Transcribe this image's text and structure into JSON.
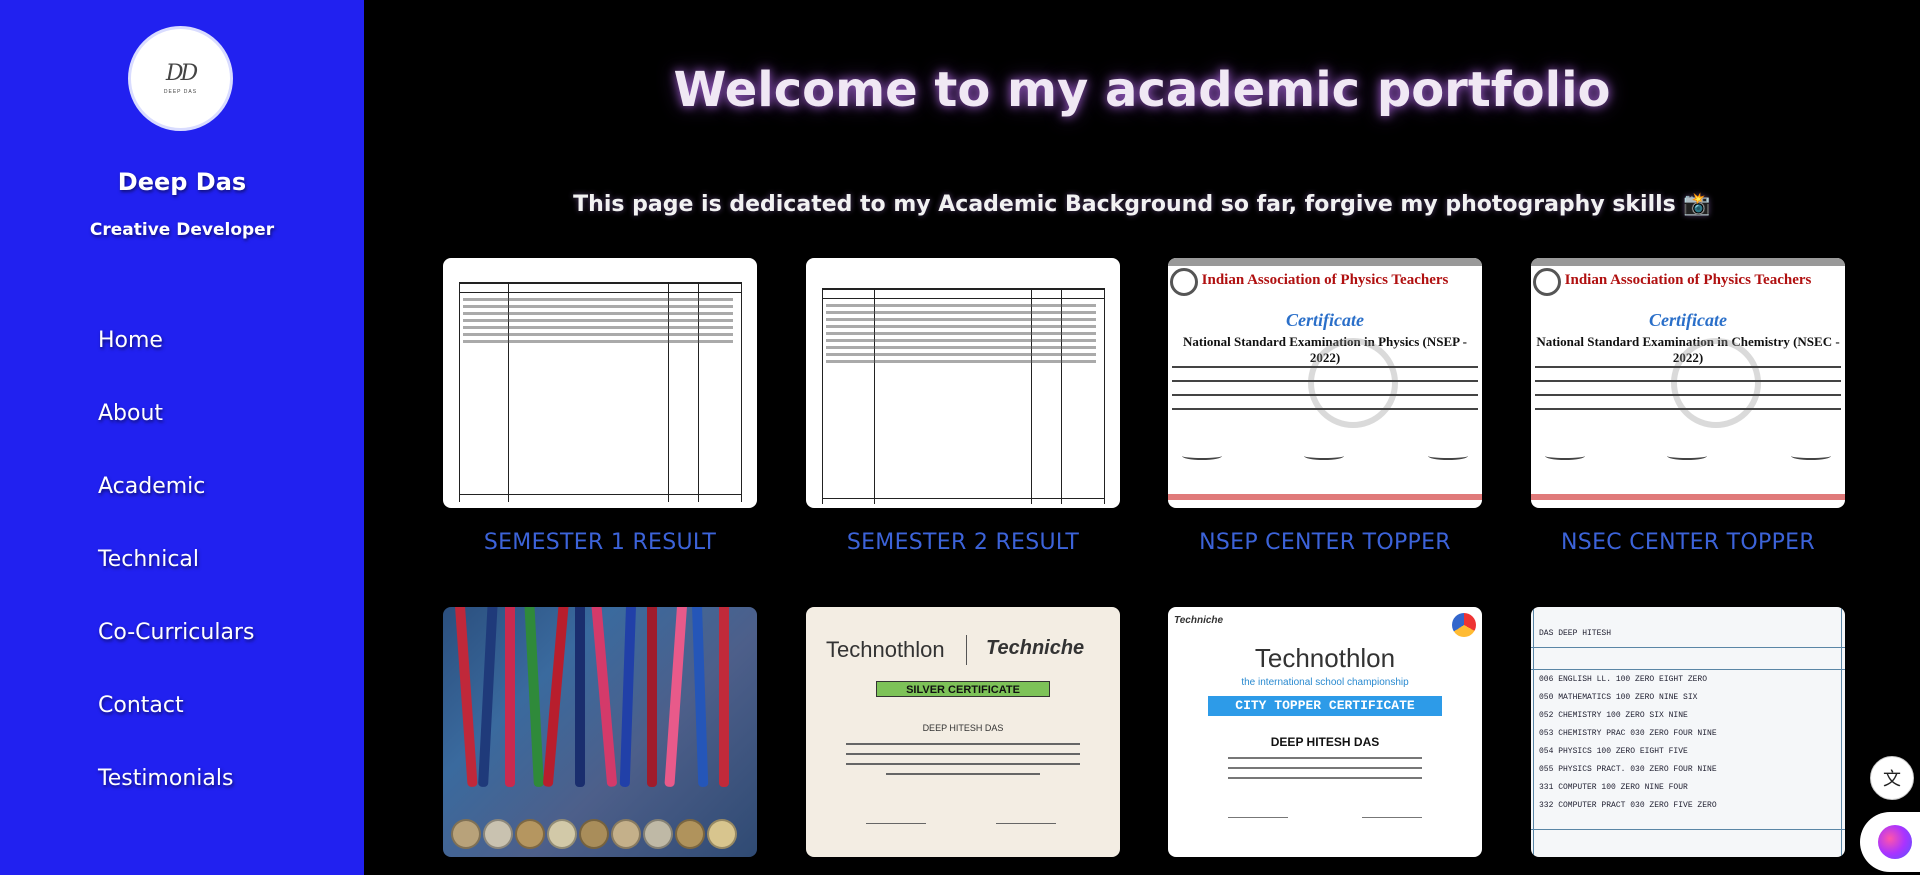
{
  "sidebar": {
    "avatar": {
      "monogram": "DD",
      "small_text": "DEEP DAS"
    },
    "name": "Deep Das",
    "role": "Creative Developer",
    "nav": [
      "Home",
      "About",
      "Academic",
      "Technical",
      "Co-Curriculars",
      "Contact",
      "Testimonials"
    ]
  },
  "main": {
    "heading": "Welcome to my academic portfolio",
    "subheading": "This page is dedicated to my Academic Background so far, forgive my photography skills 📸"
  },
  "cards": [
    {
      "caption": "SEMESTER 1 RESULT"
    },
    {
      "caption": "SEMESTER 2 RESULT"
    },
    {
      "caption": "NSEP CENTER TOPPER",
      "cert_title": "Indian Association of Physics Teachers",
      "cert_word": "Certificate",
      "exam": "National Standard Examination in Physics (NSEP - 2022)"
    },
    {
      "caption": "NSEC CENTER TOPPER",
      "cert_title": "Indian Association of Physics Teachers",
      "cert_word": "Certificate",
      "exam": "National Standard Examination in Chemistry (NSEC - 2022)"
    },
    {
      "caption": ""
    },
    {
      "caption": "",
      "brand": "Technothlon",
      "brand2": "Techniche",
      "badge": "SILVER CERTIFICATE",
      "name": "DEEP HITESH DAS"
    },
    {
      "caption": "",
      "brand_small": "Techniche",
      "brand": "Technothlon",
      "sub": "the international school championship",
      "badge": "CITY TOPPER CERTIFICATE",
      "name": "DEEP HITESH DAS"
    },
    {
      "caption": "",
      "student": "DAS DEEP HITESH",
      "rows": [
        "006 ENGLISH LL.    100  ZERO EIGHT ZERO",
        "050 MATHEMATICS    100  ZERO NINE SIX",
        "052 CHEMISTRY      100  ZERO SIX NINE",
        "053 CHEMISTRY PRAC 030  ZERO FOUR NINE",
        "054 PHYSICS        100  ZERO EIGHT FIVE",
        "055 PHYSICS PRACT. 030  ZERO FOUR NINE",
        "331 COMPUTER       100  ZERO NINE FOUR",
        "332 COMPUTER PRACT 030  ZERO FIVE ZERO"
      ]
    }
  ],
  "colors": {
    "sidebar_bg": "#2121f0",
    "page_bg": "#000000",
    "caption": "#3c63d9"
  },
  "icons": [
    "translate-icon",
    "brain-icon"
  ]
}
